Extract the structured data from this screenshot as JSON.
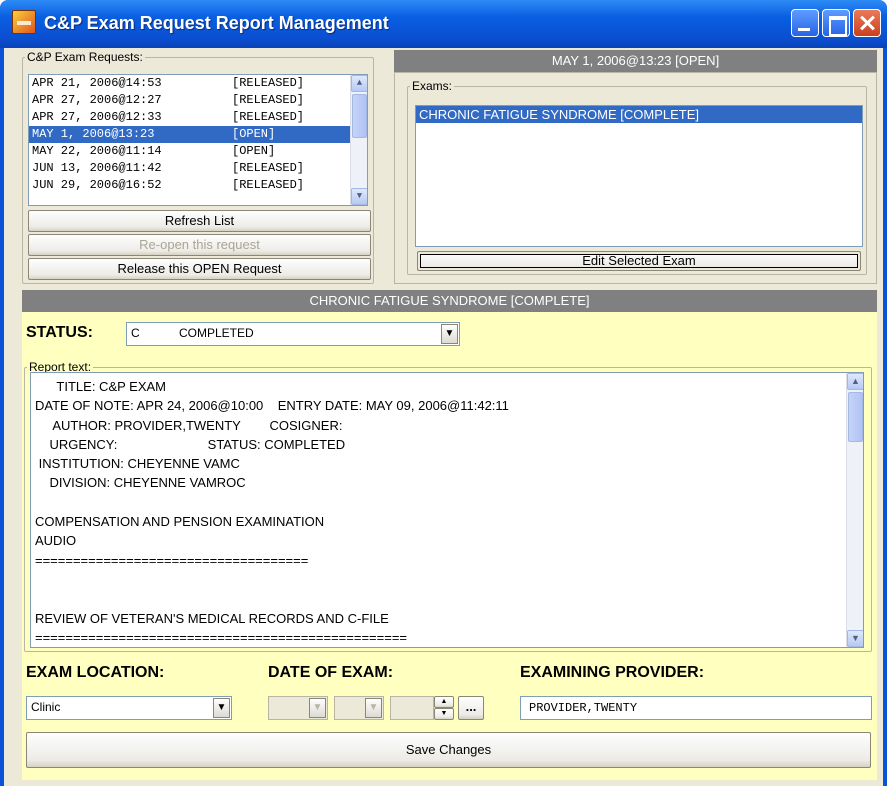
{
  "window": {
    "title": "C&P Exam Request Report Management"
  },
  "requests": {
    "legend": "C&P Exam Requests:",
    "items": [
      {
        "date": "APR 21, 2006@14:53",
        "status": "[RELEASED]"
      },
      {
        "date": "APR 27, 2006@12:27",
        "status": "[RELEASED]"
      },
      {
        "date": "APR 27, 2006@12:33",
        "status": "[RELEASED]"
      },
      {
        "date": "MAY 1, 2006@13:23",
        "status": "[OPEN]"
      },
      {
        "date": "MAY 22, 2006@11:14",
        "status": "[OPEN]"
      },
      {
        "date": "JUN 13, 2006@11:42",
        "status": "[RELEASED]"
      },
      {
        "date": "JUN 29, 2006@16:52",
        "status": "[RELEASED]"
      }
    ],
    "selected_index": 3,
    "refresh_label": "Refresh List",
    "reopen_label": "Re-open this request",
    "release_label": "Release this OPEN Request"
  },
  "exams_panel": {
    "header": "MAY 1, 2006@13:23  [OPEN]",
    "legend": "Exams:",
    "items": [
      "CHRONIC FATIGUE SYNDROME [COMPLETE]"
    ],
    "edit_label": "Edit Selected Exam"
  },
  "exam_header": "CHRONIC FATIGUE SYNDROME [COMPLETE]",
  "status": {
    "label": "STATUS:",
    "code": "C",
    "value": "COMPLETED"
  },
  "report": {
    "legend": "Report text:",
    "lines": [
      "      TITLE: C&P EXAM",
      "DATE OF NOTE: APR 24, 2006@10:00    ENTRY DATE: MAY 09, 2006@11:42:11",
      "     AUTHOR: PROVIDER,TWENTY        COSIGNER:",
      "    URGENCY:                         STATUS: COMPLETED",
      " INSTITUTION: CHEYENNE VAMC",
      "    DIVISION: CHEYENNE VAMROC",
      "",
      "COMPENSATION AND PENSION EXAMINATION",
      "AUDIO",
      "====================================",
      "",
      "",
      "REVIEW OF VETERAN'S MEDICAL RECORDS AND C-FILE",
      "================================================="
    ]
  },
  "exam_location": {
    "label": "EXAM LOCATION:",
    "value": "Clinic"
  },
  "date_of_exam": {
    "label": "DATE OF EXAM:",
    "browse_label": "..."
  },
  "examining_provider": {
    "label": "EXAMINING PROVIDER:",
    "value": "PROVIDER,TWENTY"
  },
  "save_label": "Save Changes",
  "colors": {
    "titlebar": "#0a5fe2",
    "selection": "#316ac5",
    "yellow_panel": "#ffffc0",
    "header_gray": "#808080"
  }
}
